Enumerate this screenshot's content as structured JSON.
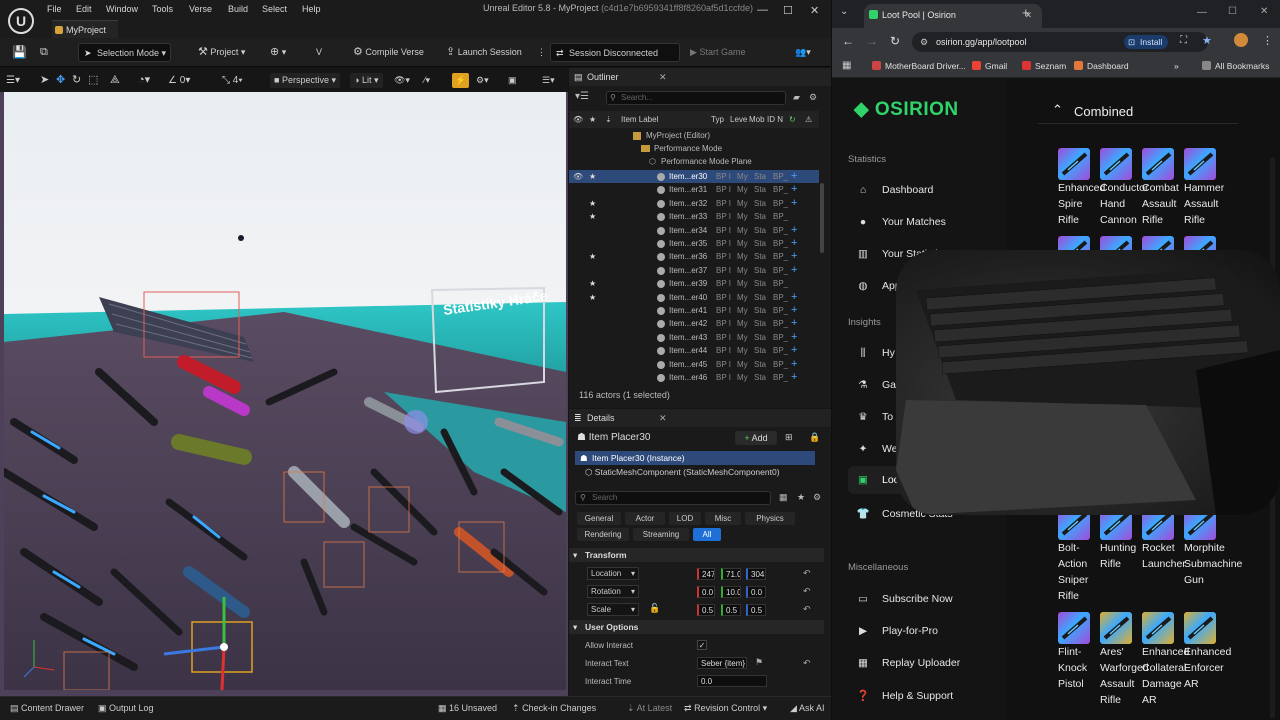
{
  "ue": {
    "menu": [
      "File",
      "Edit",
      "Window",
      "Tools",
      "Verse",
      "Build",
      "Select",
      "Help"
    ],
    "window_title": "Unreal Editor 5.8 - MyProject",
    "window_hash": "(c4d1e7b6959341ff8f8260af5d1ccfde)",
    "project_tab": "MyProject",
    "toolbar": {
      "selection_mode": "Selection Mode",
      "project": "Project",
      "compile_verse": "Compile Verse",
      "launch_session": "Launch Session",
      "session": "Session Disconnected",
      "start_game": "Start Game"
    },
    "viewport": {
      "perspective": "Perspective",
      "lit": "Lit",
      "snap_angle": "0",
      "snap_scale": "4",
      "sign_text": "Statistiky Hráče"
    },
    "outliner": {
      "title": "Outliner",
      "search_placeholder": "Search...",
      "col_label": "Item Label",
      "col_type": "Typ",
      "col_level": "Leve",
      "col_mob": "Mob",
      "col_id": "ID N",
      "tree": [
        "MyProject (Editor)",
        "Performance Mode",
        "Performance Mode Plane"
      ],
      "rows": [
        {
          "name": "Item...er30",
          "selected": true,
          "starred": true,
          "plus": true
        },
        {
          "name": "Item...er31",
          "selected": false,
          "starred": false,
          "plus": true
        },
        {
          "name": "Item...er32",
          "selected": false,
          "starred": true,
          "plus": true
        },
        {
          "name": "Item...er33",
          "selected": false,
          "starred": true,
          "plus": false
        },
        {
          "name": "Item...er34",
          "selected": false,
          "starred": false,
          "plus": true
        },
        {
          "name": "Item...er35",
          "selected": false,
          "starred": false,
          "plus": true
        },
        {
          "name": "Item...er36",
          "selected": false,
          "starred": true,
          "plus": true
        },
        {
          "name": "Item...er37",
          "selected": false,
          "starred": false,
          "plus": true
        },
        {
          "name": "Item...er39",
          "selected": false,
          "starred": true,
          "plus": false
        },
        {
          "name": "Item...er40",
          "selected": false,
          "starred": true,
          "plus": true
        },
        {
          "name": "Item...er41",
          "selected": false,
          "starred": false,
          "plus": true
        },
        {
          "name": "Item...er42",
          "selected": false,
          "starred": false,
          "plus": true
        },
        {
          "name": "Item...er43",
          "selected": false,
          "starred": false,
          "plus": true
        },
        {
          "name": "Item...er44",
          "selected": false,
          "starred": false,
          "plus": true
        },
        {
          "name": "Item...er45",
          "selected": false,
          "starred": false,
          "plus": true
        },
        {
          "name": "Item...er46",
          "selected": false,
          "starred": false,
          "plus": true
        }
      ],
      "row_type": "BP I",
      "row_level": "My",
      "row_mob": "Sta",
      "row_id": "BP_",
      "footer": "116 actors (1 selected)"
    },
    "details": {
      "title": "Details",
      "actor": "Item Placer30",
      "add": "Add",
      "instance": "Item Placer30 (Instance)",
      "component": "StaticMeshComponent (StaticMeshComponent0)",
      "search_placeholder": "Search",
      "filters": [
        "General",
        "Actor",
        "LOD",
        "Misc",
        "Physics",
        "Rendering",
        "Streaming",
        "All"
      ],
      "transform_header": "Transform",
      "location": "Location",
      "rotation": "Rotation",
      "scale": "Scale",
      "loc_vals": [
        "247",
        "71.0",
        "304"
      ],
      "rot_vals": [
        "0.0",
        "10.0",
        "0.0"
      ],
      "scale_vals": [
        "0.5",
        "0.5",
        "0.5"
      ],
      "user_options": "User Options",
      "allow_interact": "Allow Interact",
      "interact_text": "Interact Text",
      "interact_text_val": "Seber {item}",
      "interact_time": "Interact Time",
      "interact_time_val": "0.0"
    },
    "status": {
      "content_drawer": "Content Drawer",
      "output_log": "Output Log",
      "unsaved": "16 Unsaved",
      "checkin": "Check-in Changes",
      "at_latest": "At Latest",
      "revision": "Revision Control",
      "ask_ai": "Ask AI"
    }
  },
  "browser": {
    "tab_title": "Loot Pool | Osirion",
    "url": "osirion.gg/app/lootpool",
    "install": "Install",
    "bookmarks": [
      "MotherBoard Driver...",
      "Gmail",
      "Seznam",
      "Dashboard"
    ],
    "all_bookmarks": "All Bookmarks",
    "brand": "OSIRION",
    "sections": {
      "statistics": "Statistics",
      "insights": "Insights",
      "misc": "Miscellaneous"
    },
    "nav_stats": [
      "Dashboard",
      "Your Matches",
      "Your Statistics",
      "App"
    ],
    "nav_insights": [
      "Hy",
      "Ga",
      "To",
      "We",
      "Loo",
      "Cosmetic Stats"
    ],
    "nav_misc": [
      "Subscribe Now",
      "Play-for-Pro",
      "Replay Uploader",
      "Help & Support"
    ],
    "combined": "Combined",
    "items_row1": [
      {
        "lines": [
          "Enhanced",
          "Spire",
          "Rifle"
        ],
        "color": "#a24bd8"
      },
      {
        "lines": [
          "Conductor",
          "Hand",
          "Cannon"
        ],
        "color": "#a24bd8"
      },
      {
        "lines": [
          "Combat",
          "Assault",
          "Rifle"
        ],
        "color": "#a24bd8"
      },
      {
        "lines": [
          "Hammer",
          "Assault",
          "Rifle"
        ],
        "color": "#a24bd8"
      }
    ],
    "items_row3": [
      {
        "lines": [
          "Bolt-",
          "Action",
          "Sniper",
          "Rifle"
        ],
        "color": "#a24bd8"
      },
      {
        "lines": [
          "Hunting",
          "Rifle"
        ],
        "color": "#a24bd8"
      },
      {
        "lines": [
          "Rocket",
          "Launcher"
        ],
        "color": "#a24bd8"
      },
      {
        "lines": [
          "Morphite",
          "Submachine",
          "Gun"
        ],
        "color": "#a24bd8"
      }
    ],
    "items_row4": [
      {
        "lines": [
          "Flint-",
          "Knock",
          "Pistol"
        ],
        "color": "#a24bd8"
      },
      {
        "lines": [
          "Ares'",
          "Warforged",
          "Assault",
          "Rifle"
        ],
        "color": "#e0b030"
      },
      {
        "lines": [
          "Enhanced",
          "Collateral",
          "Damage",
          "AR"
        ],
        "color": "#e0b030"
      },
      {
        "lines": [
          "Enhanced",
          "Enforcer",
          "AR"
        ],
        "color": "#e0b030"
      }
    ]
  }
}
